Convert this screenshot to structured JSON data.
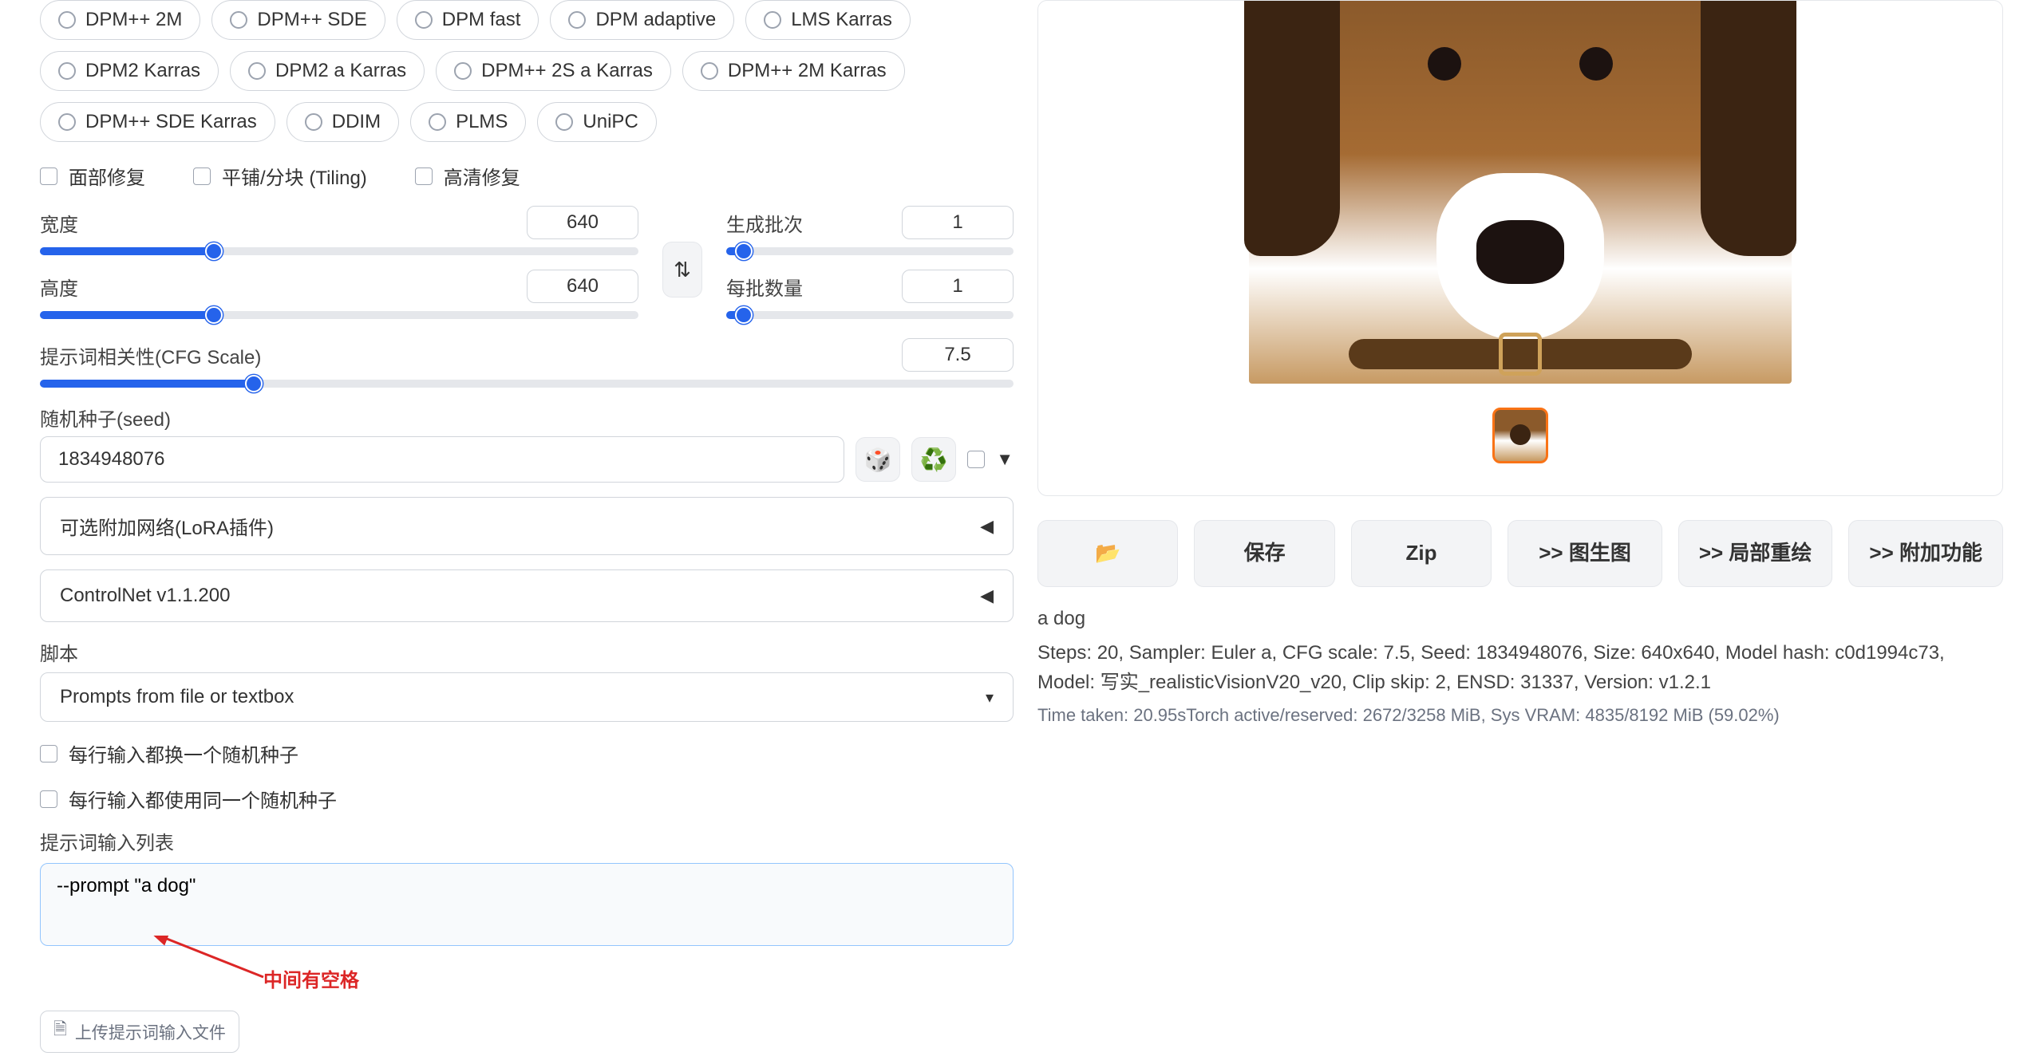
{
  "samplers": [
    "DPM++ 2M",
    "DPM++ SDE",
    "DPM fast",
    "DPM adaptive",
    "LMS Karras",
    "DPM2 Karras",
    "DPM2 a Karras",
    "DPM++ 2S a Karras",
    "DPM++ 2M Karras",
    "DPM++ SDE Karras",
    "DDIM",
    "PLMS",
    "UniPC"
  ],
  "checkboxes": {
    "face_restore": "面部修复",
    "tiling": "平铺/分块 (Tiling)",
    "hires": "高清修复"
  },
  "dims": {
    "width_label": "宽度",
    "width_value": "640",
    "width_fraction": 0.29,
    "height_label": "高度",
    "height_value": "640",
    "height_fraction": 0.29,
    "batch_count_label": "生成批次",
    "batch_count_value": "1",
    "batch_size_label": "每批数量",
    "batch_size_value": "1"
  },
  "cfg": {
    "label": "提示词相关性(CFG Scale)",
    "value": "7.5",
    "fraction": 0.22
  },
  "seed": {
    "label": "随机种子(seed)",
    "value": "1834948076"
  },
  "accordions": {
    "lora": "可选附加网络(LoRA插件)",
    "controlnet": "ControlNet v1.1.200"
  },
  "script": {
    "label": "脚本",
    "selected": "Prompts from file or textbox"
  },
  "script_opts": {
    "iterate_seed": "每行输入都换一个随机种子",
    "same_seed": "每行输入都使用同一个随机种子",
    "list_label": "提示词输入列表",
    "list_value": "--prompt \"a dog\"",
    "annotation": "中间有空格",
    "upload_label": "上传提示词输入文件"
  },
  "result": {
    "buttons": {
      "folder": "📂",
      "save": "保存",
      "zip": "Zip",
      "img2img": ">> 图生图",
      "inpaint": ">> 局部重绘",
      "extras": ">> 附加功能"
    },
    "prompt": "a dog",
    "params": "Steps: 20, Sampler: Euler a, CFG scale: 7.5, Seed: 1834948076, Size: 640x640, Model hash: c0d1994c73, Model: 写实_realisticVisionV20_v20, Clip skip: 2, ENSD: 31337, Version: v1.2.1",
    "time": "Time taken: 20.95sTorch active/reserved: 2672/3258 MiB, Sys VRAM: 4835/8192 MiB (59.02%)"
  }
}
